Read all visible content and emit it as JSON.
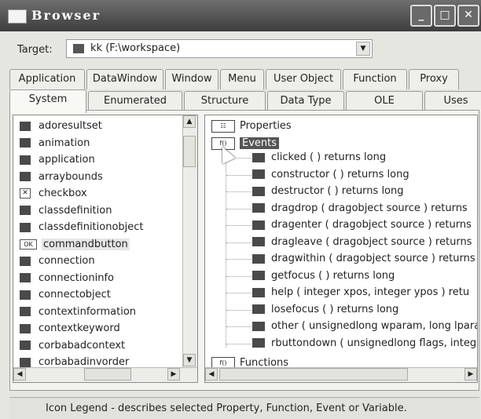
{
  "window": {
    "title": "Browser",
    "buttons": [
      "_",
      "□",
      "✕"
    ]
  },
  "target": {
    "label": "Target:",
    "value": "kk (F:\\workspace)"
  },
  "tabs_row1": [
    "Application",
    "DataWindow",
    "Window",
    "Menu",
    "User Object",
    "Function",
    "Proxy"
  ],
  "tabs_row2": [
    "System",
    "Enumerated",
    "Structure",
    "Data Type",
    "OLE",
    "Uses"
  ],
  "selected_tab": "System",
  "left_list": [
    {
      "label": "adoresultset",
      "icon": "object-icon"
    },
    {
      "label": "animation",
      "icon": "object-icon"
    },
    {
      "label": "application",
      "icon": "application-icon"
    },
    {
      "label": "arraybounds",
      "icon": "object-icon"
    },
    {
      "label": "checkbox",
      "icon": "checkbox-icon"
    },
    {
      "label": "classdefinition",
      "icon": "object-icon"
    },
    {
      "label": "classdefinitionobject",
      "icon": "object-icon"
    },
    {
      "label": "commandbutton",
      "icon": "ok-button-icon",
      "selected": true
    },
    {
      "label": "connection",
      "icon": "object-icon"
    },
    {
      "label": "connectioninfo",
      "icon": "object-icon"
    },
    {
      "label": "connectobject",
      "icon": "object-icon"
    },
    {
      "label": "contextinformation",
      "icon": "object-icon"
    },
    {
      "label": "contextkeyword",
      "icon": "object-icon"
    },
    {
      "label": "corbabadcontext",
      "icon": "object-icon"
    },
    {
      "label": "corbabadinvorder",
      "icon": "object-icon"
    }
  ],
  "tree": {
    "properties": "Properties",
    "events": "Events",
    "event_items": [
      "clicked ( ) returns long",
      "constructor ( ) returns long",
      "destructor ( ) returns long",
      "dragdrop ( dragobject source ) returns",
      "dragenter ( dragobject source ) returns",
      "dragleave ( dragobject source ) returns",
      "dragwithin ( dragobject source ) returns",
      "getfocus ( ) returns long",
      "help ( integer xpos, integer ypos ) retu",
      "losefocus ( ) returns long",
      "other ( unsignedlong wparam, long lpara",
      "rbuttondown ( unsignedlong flags, integ"
    ],
    "functions": "Functions",
    "node_icon_text": "f()"
  },
  "status": "Icon Legend - describes selected Property, Function, Event or Variable."
}
